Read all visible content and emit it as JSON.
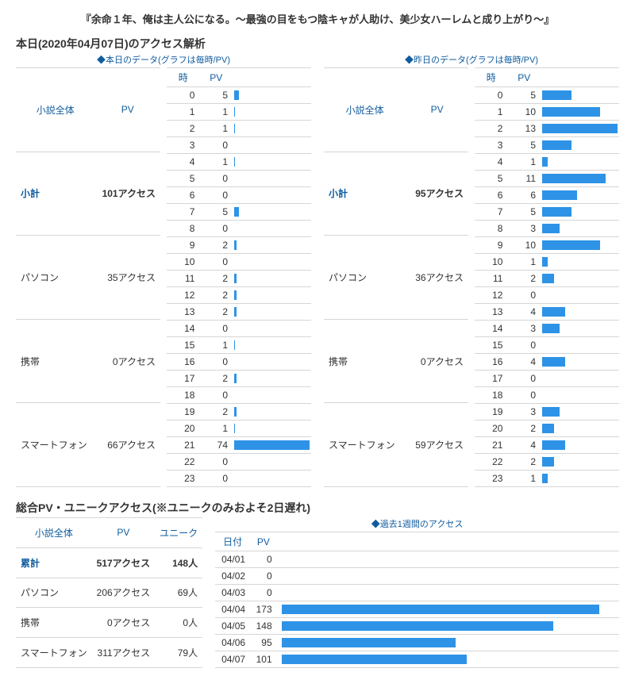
{
  "title": "『余命１年、俺は主人公になる。～最強の目をもつ陰キャが人助け、美少女ハーレムと成り上がり～』",
  "section_today": "本日(2020年04月07日)のアクセス解析",
  "cap_today": "◆本日のデータ(グラフは毎時/PV)",
  "cap_yest": "◆昨日のデータ(グラフは毎時/PV)",
  "section_total": "総合PV・ユニークアクセス(※ユニークのみおよそ2日遅れ)",
  "cap_week": "◆過去1週間のアクセス",
  "h": {
    "overall": "小説全体",
    "pv": "PV",
    "unique": "ユニーク",
    "hour": "時",
    "date": "日付",
    "subtotal": "小計",
    "total": "累計",
    "pc": "パソコン",
    "mobile": "携帯",
    "sp": "スマートフォン"
  },
  "today_sum": {
    "subtotal": "101アクセス",
    "pc": "35アクセス",
    "mobile": "0アクセス",
    "sp": "66アクセス"
  },
  "yest_sum": {
    "subtotal": "95アクセス",
    "pc": "36アクセス",
    "mobile": "0アクセス",
    "sp": "59アクセス"
  },
  "total_sum": {
    "pv_total": "517アクセス",
    "uq_total": "148人",
    "pv_pc": "206アクセス",
    "uq_pc": "69人",
    "pv_mob": "0アクセス",
    "uq_mob": "0人",
    "pv_sp": "311アクセス",
    "uq_sp": "79人"
  },
  "chart_data": {
    "today_hourly": {
      "type": "bar",
      "xlabel": "時",
      "ylabel": "PV",
      "categories": [
        0,
        1,
        2,
        3,
        4,
        5,
        6,
        7,
        8,
        9,
        10,
        11,
        12,
        13,
        14,
        15,
        16,
        17,
        18,
        19,
        20,
        21,
        22,
        23
      ],
      "values": [
        5,
        1,
        1,
        0,
        1,
        0,
        0,
        5,
        0,
        2,
        0,
        2,
        2,
        2,
        0,
        1,
        0,
        2,
        0,
        2,
        1,
        74,
        0,
        0
      ]
    },
    "yest_hourly": {
      "type": "bar",
      "xlabel": "時",
      "ylabel": "PV",
      "categories": [
        0,
        1,
        2,
        3,
        4,
        5,
        6,
        7,
        8,
        9,
        10,
        11,
        12,
        13,
        14,
        15,
        16,
        17,
        18,
        19,
        20,
        21,
        22,
        23
      ],
      "values": [
        5,
        10,
        13,
        5,
        1,
        11,
        6,
        5,
        3,
        10,
        1,
        2,
        0,
        4,
        3,
        0,
        4,
        0,
        0,
        3,
        2,
        4,
        2,
        1
      ]
    },
    "weekly": {
      "type": "bar",
      "xlabel": "日付",
      "ylabel": "PV",
      "categories": [
        "04/01",
        "04/02",
        "04/03",
        "04/04",
        "04/05",
        "04/06",
        "04/07"
      ],
      "values": [
        0,
        0,
        0,
        173,
        148,
        95,
        101
      ]
    }
  }
}
